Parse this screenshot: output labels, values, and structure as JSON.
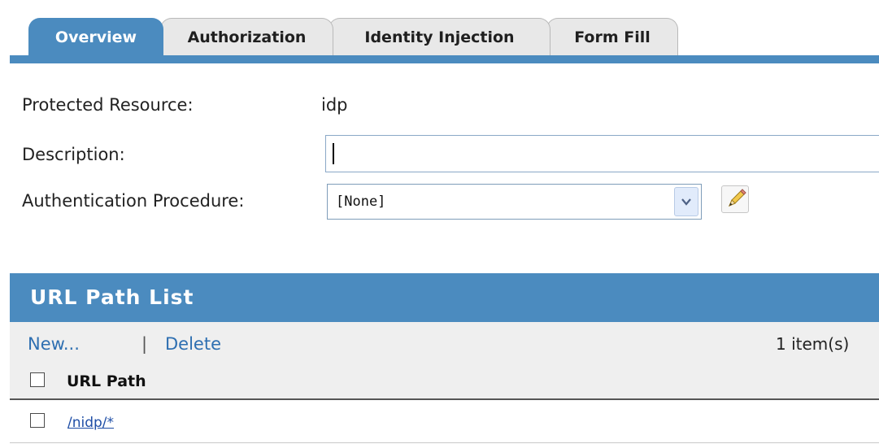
{
  "tabs": [
    {
      "label": "Overview",
      "active": true
    },
    {
      "label": "Authorization",
      "active": false
    },
    {
      "label": "Identity Injection",
      "active": false
    },
    {
      "label": "Form Fill",
      "active": false
    }
  ],
  "overview": {
    "protected_resource_label": "Protected Resource:",
    "protected_resource_value": "idp",
    "description_label": "Description:",
    "description_value": "",
    "auth_procedure_label": "Authentication Procedure:",
    "auth_procedure_selected": "[None]",
    "edit_icon": "pencil-icon"
  },
  "url_path_list": {
    "title": "URL Path List",
    "new_label": "New...",
    "separator": "|",
    "delete_label": "Delete",
    "item_count": "1 item(s)",
    "column_header": "URL Path",
    "rows": [
      {
        "path": "/nidp/*"
      }
    ]
  },
  "colors": {
    "accent": "#4b8bbf",
    "link": "#2e6fb1",
    "toolbar_bg": "#efefef"
  }
}
